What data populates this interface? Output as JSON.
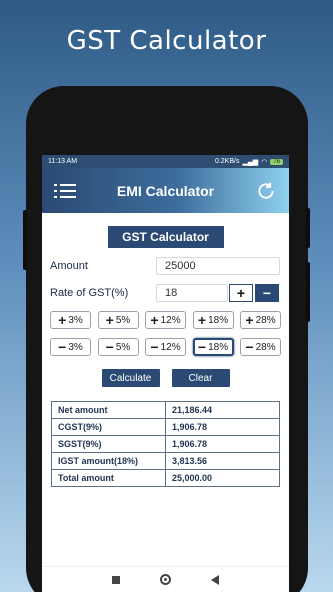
{
  "promo": {
    "title": "GST Calculator"
  },
  "status": {
    "time": "11:13 AM",
    "speed": "0.2KB/s",
    "battery": "76"
  },
  "appbar": {
    "title": "EMI Calculator",
    "menu_icon": "menu-icon",
    "refresh_icon": "refresh-icon"
  },
  "section": {
    "title": "GST Calculator"
  },
  "form": {
    "amount_label": "Amount",
    "amount_value": "25000",
    "rate_label": "Rate of GST(%)",
    "rate_value": "18",
    "plus": "+",
    "minus": "−"
  },
  "plus_chips": [
    "3%",
    "5%",
    "12%",
    "18%",
    "28%"
  ],
  "minus_chips": [
    "3%",
    "5%",
    "12%",
    "18%",
    "28%"
  ],
  "selected_minus_chip": "18%",
  "buttons": {
    "calculate": "Calculate",
    "clear": "Clear"
  },
  "results": [
    {
      "label": "Net amount",
      "value": "21,186.44"
    },
    {
      "label": "CGST(9%)",
      "value": "1,906.78"
    },
    {
      "label": "SGST(9%)",
      "value": "1,906.78"
    },
    {
      "label": "IGST amount(18%)",
      "value": "3,813.56"
    },
    {
      "label": "Total amount",
      "value": "25,000.00"
    }
  ]
}
